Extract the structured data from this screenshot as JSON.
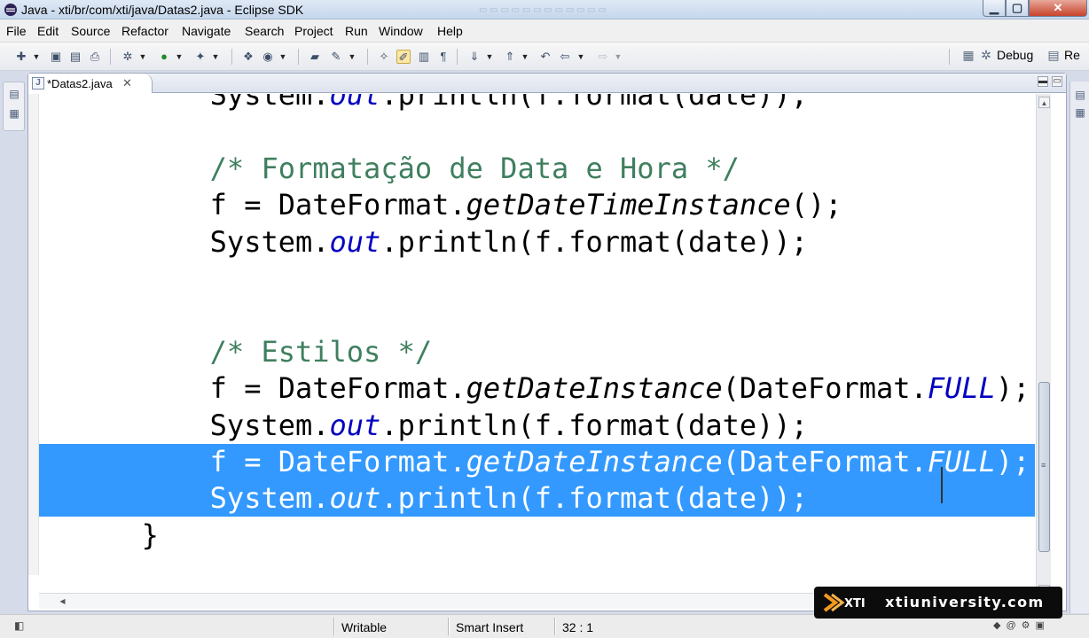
{
  "window": {
    "title": "Java - xti/br/com/xti/java/Datas2.java - Eclipse SDK",
    "controls": {
      "minimize": "▁",
      "maximize": "▢",
      "close": "✕"
    }
  },
  "menu": [
    "File",
    "Edit",
    "Source",
    "Refactor",
    "Navigate",
    "Search",
    "Project",
    "Run",
    "Window",
    "Help"
  ],
  "toolbar": {
    "perspectives": [
      {
        "label": "Debug",
        "icon": "debug-perspective-icon"
      },
      {
        "label": "Re",
        "icon": "resource-perspective-icon"
      }
    ]
  },
  "editor": {
    "tab": {
      "label": "*Datas2.java",
      "close": "✕",
      "icon": "java-file-icon"
    },
    "view_controls": {
      "minimize": "▬",
      "maximize": "▭"
    },
    "code_lines": [
      {
        "segments": [
          {
            "t": "        System."
          },
          {
            "t": "out",
            "c": "fld"
          },
          {
            "t": ".println(f.format(date));"
          }
        ],
        "selected": false
      },
      {
        "segments": [
          {
            "t": ""
          }
        ],
        "selected": false
      },
      {
        "segments": [
          {
            "t": "        "
          },
          {
            "t": "/* Formatação de Data e Hora */",
            "c": "cm"
          }
        ],
        "selected": false
      },
      {
        "segments": [
          {
            "t": "        f = DateFormat."
          },
          {
            "t": "getDateTimeInstance",
            "c": "st"
          },
          {
            "t": "();"
          }
        ],
        "selected": false
      },
      {
        "segments": [
          {
            "t": "        System."
          },
          {
            "t": "out",
            "c": "fld"
          },
          {
            "t": ".println(f.format(date));"
          }
        ],
        "selected": false
      },
      {
        "segments": [
          {
            "t": ""
          }
        ],
        "selected": false
      },
      {
        "segments": [
          {
            "t": ""
          }
        ],
        "selected": false
      },
      {
        "segments": [
          {
            "t": "        "
          },
          {
            "t": "/* Estilos */",
            "c": "cm"
          }
        ],
        "selected": false
      },
      {
        "segments": [
          {
            "t": "        f = DateFormat."
          },
          {
            "t": "getDateInstance",
            "c": "st"
          },
          {
            "t": "(DateFormat."
          },
          {
            "t": "FULL",
            "c": "fld"
          },
          {
            "t": ");"
          }
        ],
        "selected": false
      },
      {
        "segments": [
          {
            "t": "        System."
          },
          {
            "t": "out",
            "c": "fld"
          },
          {
            "t": ".println(f.format(date));"
          }
        ],
        "selected": false
      },
      {
        "segments": [
          {
            "t": "        f = DateFormat."
          },
          {
            "t": "getDateInstance",
            "c": "st"
          },
          {
            "t": "(DateFormat."
          },
          {
            "t": "FULL",
            "c": "fld"
          },
          {
            "t": ");"
          }
        ],
        "selected": true
      },
      {
        "segments": [
          {
            "t": "        System."
          },
          {
            "t": "out",
            "c": "fld"
          },
          {
            "t": ".println(f.format(date));"
          }
        ],
        "selected": true
      },
      {
        "segments": [
          {
            "t": "    }"
          }
        ],
        "selected": false
      }
    ]
  },
  "statusbar": {
    "mode": "Writable",
    "insert_mode": "Smart Insert",
    "position": "32 : 1"
  },
  "watermark": {
    "text": "xtiuniversity.com",
    "logo_text": "XTI"
  },
  "colors": {
    "selection": "#3399ff",
    "comment": "#3f7f5f",
    "field": "#0000c0"
  }
}
